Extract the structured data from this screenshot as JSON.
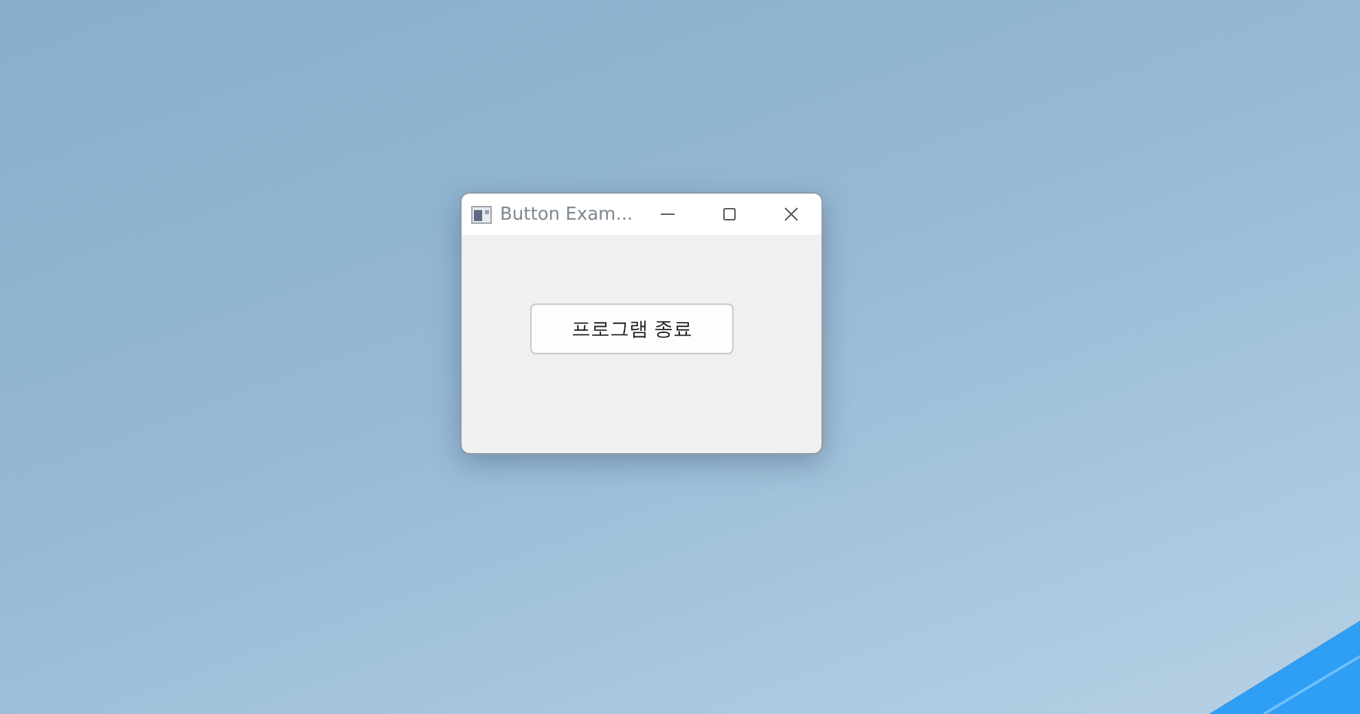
{
  "window": {
    "title": "Button Exam...",
    "buttons": [
      {
        "kind": "minimize"
      },
      {
        "kind": "maximize"
      },
      {
        "kind": "close"
      }
    ]
  },
  "content": {
    "button": {
      "label": "프로그램 종료"
    }
  }
}
